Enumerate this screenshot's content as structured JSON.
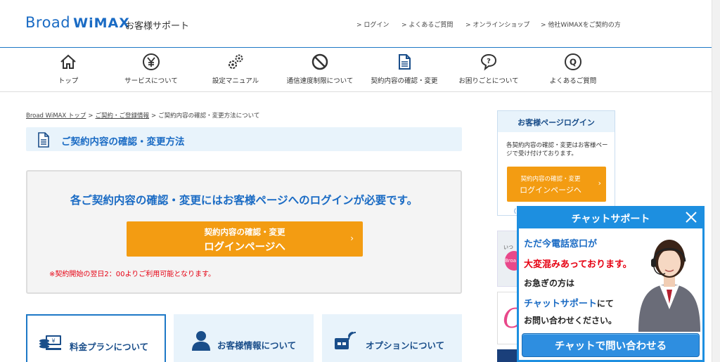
{
  "header": {
    "logo_main": "Broad",
    "logo_brand": "WiMAX",
    "logo_sub": "お客様サポート",
    "links": [
      "ログイン",
      "よくあるご質問",
      "オンラインショップ",
      "他社WiMAXをご契約の方"
    ]
  },
  "gnav": {
    "items": [
      {
        "label": "トップ",
        "icon": "home-icon"
      },
      {
        "label": "サービスについて",
        "icon": "yen-icon"
      },
      {
        "label": "設定マニュアル",
        "icon": "gears-icon"
      },
      {
        "label": "通信速度制限について",
        "icon": "prohibited-icon"
      },
      {
        "label": "契約内容の確認・変更",
        "icon": "document-icon"
      },
      {
        "label": "お困りごとについて",
        "icon": "question-icon"
      },
      {
        "label": "よくあるご質問",
        "icon": "q-icon"
      }
    ]
  },
  "breadcrumb": {
    "items": [
      "Broad WiMAX トップ",
      "ご契約・ご登録情報",
      "ご契約内容の確認・変更方法について"
    ]
  },
  "page": {
    "title": "ご契約内容の確認・変更方法"
  },
  "notice": {
    "heading": "各ご契約内容の確認・変更にはお客様ページへのログインが必要です。",
    "button_line1": "契約内容の確認・変更",
    "button_line2": "ログインページへ",
    "note": "※契約開始の翌日2：00よりご利用可能となります。"
  },
  "tiles": [
    {
      "label": "料金プランについて",
      "icon": "money-icon"
    },
    {
      "label": "お客様情報について",
      "icon": "user-icon"
    },
    {
      "label": "オプションについて",
      "icon": "wifi-card-icon"
    }
  ],
  "sidebar": {
    "login_title": "お客様ページログイン",
    "login_desc": "各契約内容の確認・変更はお客様ページで受け付けております。",
    "login_btn_line1": "契約内容の確認・変更",
    "login_btn_line2": "ログインページへ",
    "partial_link": "（",
    "banner1_top": "いつ",
    "banner1_brand": "Broa",
    "banner2_letter": "C"
  },
  "chat": {
    "title": "チャットサポート",
    "line1": "ただ今電話窓口が",
    "line2": "大変混みあっております。",
    "line3": "お急ぎの方は",
    "line4_blue": "チャットサポート",
    "line4_rest": "にて",
    "line5": "お問い合わせください。",
    "button": "チャットで問い合わせる"
  },
  "colors": {
    "brand_blue": "#1a6bc4",
    "accent_orange": "#f39c12",
    "alert_red": "#e60012",
    "light_blue_bg": "#e8f3fb",
    "chat_blue": "#1d8fe0"
  }
}
